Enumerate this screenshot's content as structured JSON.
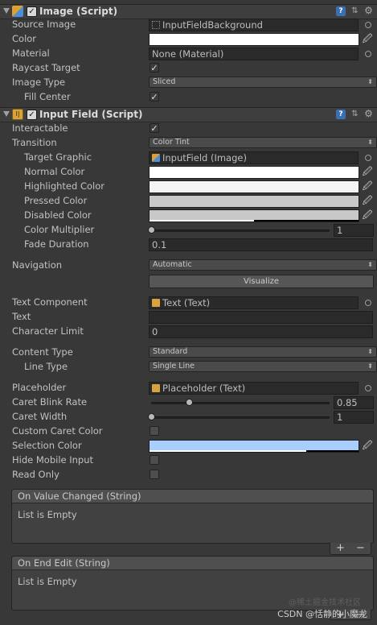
{
  "image_component": {
    "title": "Image (Script)",
    "source_image_label": "Source Image",
    "source_image_value": "InputFieldBackground",
    "color_label": "Color",
    "material_label": "Material",
    "material_value": "None (Material)",
    "raycast_label": "Raycast Target",
    "image_type_label": "Image Type",
    "image_type_value": "Sliced",
    "fill_center_label": "Fill Center"
  },
  "input_field_component": {
    "title": "Input Field (Script)",
    "interactable_label": "Interactable",
    "transition_label": "Transition",
    "transition_value": "Color Tint",
    "target_graphic_label": "Target Graphic",
    "target_graphic_value": "InputField (Image)",
    "normal_color_label": "Normal Color",
    "highlighted_color_label": "Highlighted Color",
    "pressed_color_label": "Pressed Color",
    "disabled_color_label": "Disabled Color",
    "color_multiplier_label": "Color Multiplier",
    "color_multiplier_value": "1",
    "fade_duration_label": "Fade Duration",
    "fade_duration_value": "0.1",
    "navigation_label": "Navigation",
    "navigation_value": "Automatic",
    "visualize_label": "Visualize",
    "text_component_label": "Text Component",
    "text_component_value": "Text (Text)",
    "text_label": "Text",
    "text_value": "",
    "char_limit_label": "Character Limit",
    "char_limit_value": "0",
    "content_type_label": "Content Type",
    "content_type_value": "Standard",
    "line_type_label": "Line Type",
    "line_type_value": "Single Line",
    "placeholder_label": "Placeholder",
    "placeholder_value": "Placeholder (Text)",
    "caret_blink_label": "Caret Blink Rate",
    "caret_blink_value": "0.85",
    "caret_width_label": "Caret Width",
    "caret_width_value": "1",
    "custom_caret_label": "Custom Caret Color",
    "selection_color_label": "Selection Color",
    "hide_mobile_label": "Hide Mobile Input",
    "read_only_label": "Read Only"
  },
  "events": {
    "on_value_changed_title": "On Value Changed (String)",
    "on_value_changed_empty": "List is Empty",
    "on_end_edit_title": "On End Edit (String)",
    "on_end_edit_empty": "List is Empty",
    "add_glyph": "+",
    "remove_glyph": "−"
  },
  "watermark": {
    "faint_text": "@稀土掘金技术社区",
    "csdn_text": "CSDN @恬静的小魔龙"
  },
  "colors": {
    "normal": "#ffffff",
    "highlighted": "#f5f5f5",
    "pressed": "#c8c8c8",
    "disabled": "#c8c8c8",
    "selection": "#a8cefe",
    "image_color": "#ffffff"
  },
  "values": {
    "color_multiplier_fraction": 0.0,
    "caret_blink_fraction": 0.21,
    "caret_width_fraction": 0.0,
    "disabled_alpha_fraction": 0.5,
    "selection_alpha_fraction": 0.75
  },
  "icons": {
    "help": "help-icon",
    "preset": "preset-icon",
    "gear": "gear-icon",
    "eyedropper": "eyedropper-icon",
    "object_picker": "object-picker-icon"
  }
}
